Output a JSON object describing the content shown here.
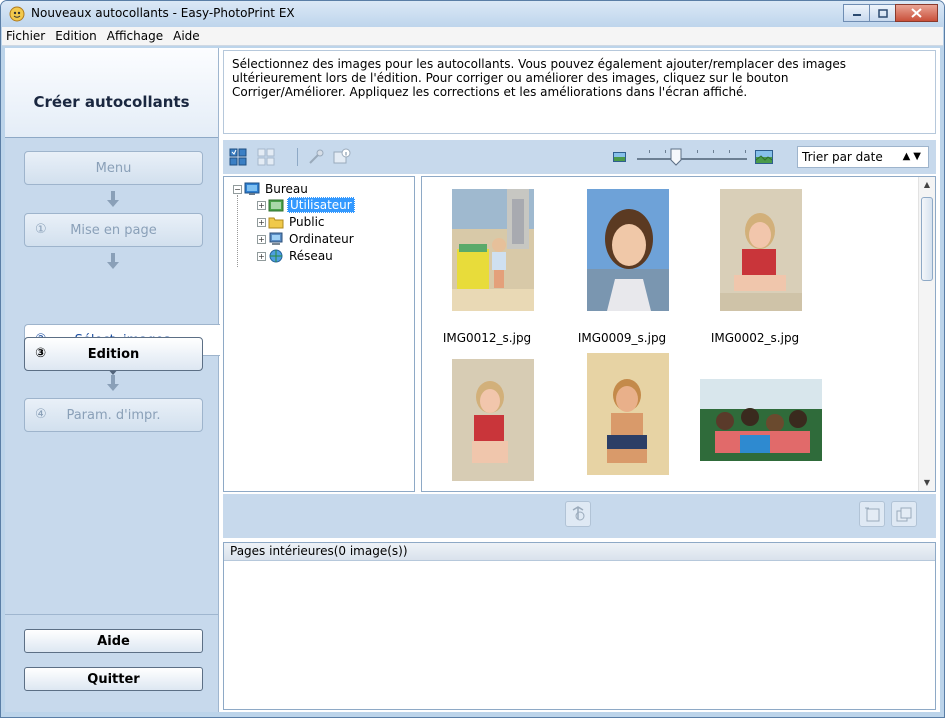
{
  "window": {
    "title": "Nouveaux autocollants - Easy-PhotoPrint EX"
  },
  "menu": {
    "items": [
      {
        "label": "Fichier"
      },
      {
        "label": "Edition"
      },
      {
        "label": "Affichage"
      },
      {
        "label": "Aide"
      }
    ]
  },
  "sidebar": {
    "title": "Créer autocollants",
    "menu_label": "Menu",
    "steps": [
      {
        "num": "①",
        "label": "Mise en page",
        "state": "disabled"
      },
      {
        "num": "②",
        "label": "Sélect. images",
        "state": "current"
      },
      {
        "num": "③",
        "label": "Edition",
        "state": "enabled"
      },
      {
        "num": "④",
        "label": "Param. d'impr.",
        "state": "disabled"
      }
    ],
    "help_label": "Aide",
    "quit_label": "Quitter"
  },
  "instructions": {
    "line1": "Sélectionnez des images pour les autocollants. Vous pouvez également ajouter/remplacer des images",
    "line2": "ultérieurement lors de l'édition. Pour corriger ou améliorer des images, cliquez sur le bouton",
    "line3": "Corriger/Améliorer. Appliquez les corrections et les améliorations dans l'écran affiché."
  },
  "toolbar": {
    "sort_label": "Trier par date",
    "zoom_level": 0.3
  },
  "tree": {
    "root": "Bureau",
    "children": [
      {
        "label": "Utilisateur",
        "selected": true
      },
      {
        "label": "Public",
        "selected": false
      },
      {
        "label": "Ordinateur",
        "selected": false
      },
      {
        "label": "Réseau",
        "selected": false
      }
    ]
  },
  "thumbnails": [
    {
      "filename": "IMG0012_s.jpg"
    },
    {
      "filename": "IMG0009_s.jpg"
    },
    {
      "filename": "IMG0002_s.jpg"
    },
    {
      "filename": ""
    },
    {
      "filename": ""
    },
    {
      "filename": ""
    }
  ],
  "pages": {
    "header": "Pages intérieures(0 image(s))"
  },
  "colors": {
    "panel_bg": "#c7d9ec",
    "selection": "#3399ff",
    "close_button": "#c9503a"
  }
}
